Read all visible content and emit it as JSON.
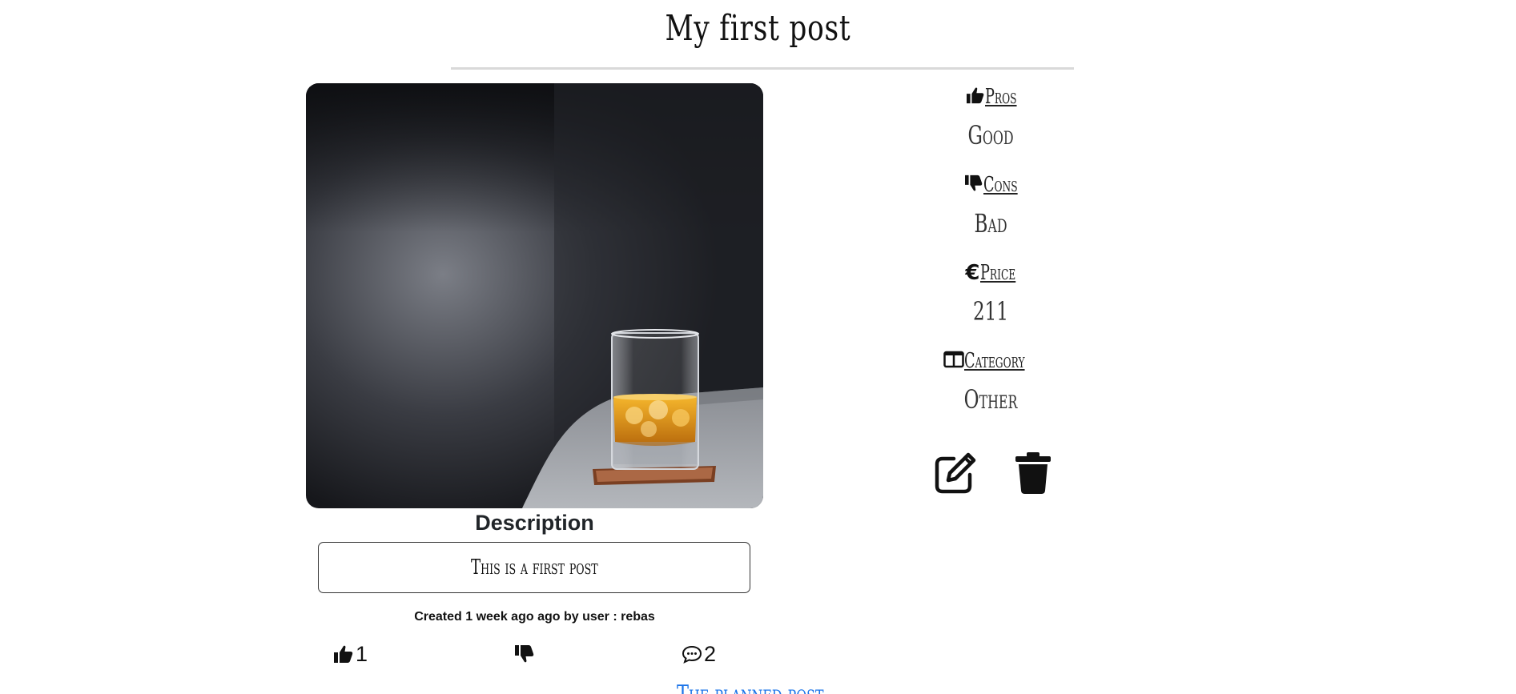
{
  "post": {
    "title": "My first post",
    "description_heading": "Description",
    "description": "This is a first post",
    "meta": "Created 1 week ago ago by user : rebas",
    "image_icon": "photo-whisky-glass-on-sofa"
  },
  "info": {
    "pros_label": "Pros",
    "pros_value": "Good",
    "cons_label": "Cons",
    "cons_value": "Bad",
    "price_label": "Price",
    "price_value": "211",
    "category_label": "Category",
    "category_value": "Other"
  },
  "reactions": {
    "likes": "1",
    "dislikes": "",
    "comments": "2"
  },
  "actions": {
    "edit_icon": "pencil-square-icon",
    "delete_icon": "trash-icon"
  },
  "footer": {
    "next_link": "The planned post"
  },
  "colors": {
    "link": "#1a73e8",
    "rule": "#d9d9d9"
  }
}
